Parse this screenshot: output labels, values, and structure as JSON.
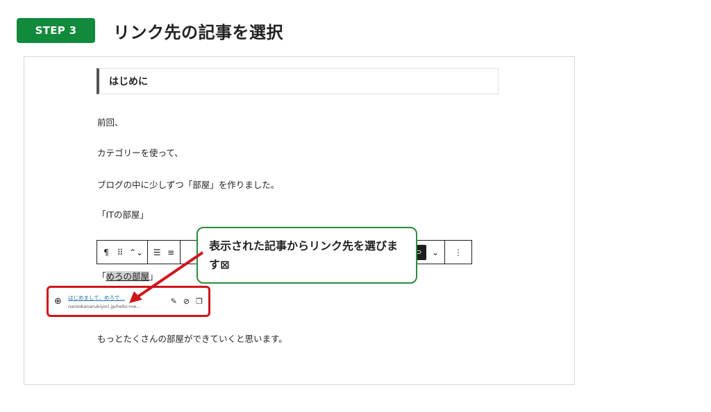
{
  "step": {
    "badge": "STEP 3",
    "title": "リンク先の記事を選択"
  },
  "editor": {
    "heading": "はじめに",
    "paragraphs": {
      "p1": "前回、",
      "p2": "カテゴリーを使って、",
      "p3": "ブログの中に少しずつ「部屋」を作りました。",
      "p4": "「ITの部屋」",
      "p5_prefix": "「",
      "p5_highlight": "めろの部屋",
      "p5_suffix": "」",
      "p6": "もっとたくさんの部屋ができていくと思います。"
    }
  },
  "toolbar": {
    "paragraph_icon": "¶",
    "drag_icon": "⠿",
    "move_icon": "⌃⌄",
    "align_icon": "☰",
    "list_icon": "≡",
    "link_icon": "⊃",
    "chevron_icon": "⌄",
    "more_icon": "⋮"
  },
  "link_popover": {
    "title": "はじめまして、めろで…",
    "url": "nantokanarubiyori.jp/hello-me…",
    "globe_icon": "⊕",
    "edit_icon": "✎",
    "unlink_icon": "⊘",
    "copy_icon": "❐"
  },
  "callout": {
    "text": "表示された記事からリンク先を選びます⊠"
  },
  "colors": {
    "badge": "#118a3c",
    "callout_border": "#2a8b3a",
    "highlight_red": "#d0151a"
  }
}
